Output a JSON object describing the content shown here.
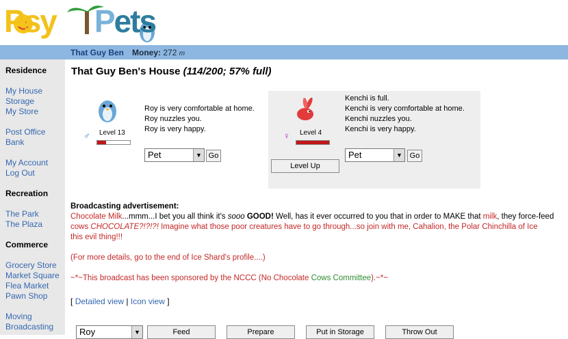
{
  "header": {
    "logo_parts": [
      "Psy",
      "P",
      "ets"
    ],
    "username": "That Guy Ben",
    "money_label": "Money:",
    "money_value": "272"
  },
  "sidebar": {
    "sections": {
      "residence": "Residence",
      "recreation": "Recreation",
      "commerce": "Commerce"
    },
    "links": {
      "my_house": "My House",
      "storage": "Storage",
      "my_store": "My Store",
      "post_office": "Post Office",
      "bank": "Bank",
      "my_account": "My Account",
      "log_out": "Log Out",
      "the_park": "The Park",
      "the_plaza": "The Plaza",
      "grocery_store": "Grocery Store",
      "market_square": "Market Square",
      "flea_market": "Flea Market",
      "pawn_shop": "Pawn Shop",
      "moving": "Moving",
      "broadcasting": "Broadcasting"
    }
  },
  "house": {
    "title": "That Guy Ben's House",
    "capacity": "(114/200; 57% full)"
  },
  "pets": [
    {
      "name": "Roy",
      "gender_symbol": "♂",
      "gender_color": "#2a6fc9",
      "level": "Level 13",
      "xp_fraction": 0.28,
      "status": [
        "Roy is very comfortable at home.",
        "Roy nuzzles you.",
        "Roy is very happy."
      ],
      "action_value": "Pet",
      "go_label": "Go"
    },
    {
      "name": "Kenchi",
      "gender_symbol": "♀",
      "gender_color": "#b02ab0",
      "level": "Level 4",
      "xp_fraction": 1.0,
      "status": [
        "Kenchi is full.",
        "Kenchi is very comfortable at home.",
        "Kenchi nuzzles you.",
        "Kenchi is very happy."
      ],
      "action_value": "Pet",
      "go_label": "Go",
      "level_up_label": "Level Up"
    }
  ],
  "broadcast": {
    "heading": "Broadcasting advertisement:",
    "p1_a": "Chocolate Milk",
    "p1_b": "...mmm...I bet you all think it's ",
    "p1_c": "sooo",
    "p1_d": " GOOD!",
    "p1_e": " Well, has it ever occurred to you that in order to MAKE that ",
    "p1_f": "milk",
    "p1_g": ", they force-feed",
    "p1_h": "cows ",
    "p1_i": "CHOCOLATE?!?!?!",
    "p1_j": " Imagine what those poor creatures have to go through...so join with me, Cahalion, the Polar Chinchilla of Ice",
    "p1_k": "this evil thing!!!",
    "p2": "(For more details, go to the end of Ice Shard's profile....)",
    "p3_a": "~*~This broadcast has been sponsored by the NCCC (No Chocolate ",
    "p3_b": "Cows",
    "p3_c": " Committee",
    "p3_d": ").~*~"
  },
  "views": {
    "open": "[",
    "detailed": "Detailed view",
    "sep": "|",
    "icon": "Icon view",
    "close": "]"
  },
  "bottom": {
    "pet_select": "Roy",
    "feed": "Feed",
    "prepare": "Prepare",
    "storage": "Put in Storage",
    "throw_out": "Throw Out"
  }
}
